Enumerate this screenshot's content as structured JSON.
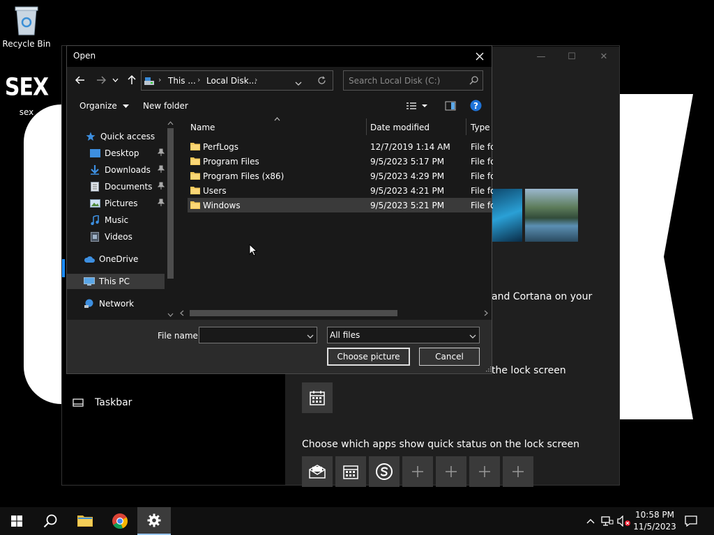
{
  "desktop": {
    "recycle_bin_label": "Recycle Bin",
    "sex_icon_big_text": "SEX",
    "sex_icon_label": "sex"
  },
  "settings": {
    "cortana_text": "and Cortana on your",
    "lock_screen_text": "the lock screen",
    "quick_status_text": "Choose which apps show quick status on the lock screen",
    "taskbar_label": "Taskbar"
  },
  "dialog": {
    "title": "Open",
    "address": {
      "seg1": "This ...",
      "seg2": "Local Disk..."
    },
    "search_placeholder": "Search Local Disk (C:)",
    "organize_label": "Organize",
    "new_folder_label": "New folder",
    "nav_items": [
      {
        "label": "Quick access",
        "icon": "star-icon"
      },
      {
        "label": "Desktop",
        "icon": "desktop-folder-icon"
      },
      {
        "label": "Downloads",
        "icon": "download-icon"
      },
      {
        "label": "Documents",
        "icon": "documents-icon"
      },
      {
        "label": "Pictures",
        "icon": "pictures-icon"
      },
      {
        "label": "Music",
        "icon": "music-icon"
      },
      {
        "label": "Videos",
        "icon": "videos-icon"
      },
      {
        "label": "OneDrive",
        "icon": "cloud-icon"
      },
      {
        "label": "This PC",
        "icon": "computer-icon"
      },
      {
        "label": "Network",
        "icon": "network-icon"
      }
    ],
    "columns": {
      "name": "Name",
      "date": "Date modified",
      "type": "Type"
    },
    "files": [
      {
        "name": "PerfLogs",
        "date": "12/7/2019 1:14 AM",
        "type": "File folder"
      },
      {
        "name": "Program Files",
        "date": "9/5/2023 5:17 PM",
        "type": "File folder"
      },
      {
        "name": "Program Files (x86)",
        "date": "9/5/2023 4:29 PM",
        "type": "File folder"
      },
      {
        "name": "Users",
        "date": "9/5/2023 4:21 PM",
        "type": "File folder"
      },
      {
        "name": "Windows",
        "date": "9/5/2023 5:21 PM",
        "type": "File folder"
      }
    ],
    "file_name_label": "File name:",
    "file_name_value": "",
    "filter_value": "All files",
    "choose_label": "Choose picture",
    "cancel_label": "Cancel"
  },
  "taskbar": {
    "time": "10:58 PM",
    "date": "11/5/2023"
  },
  "colors": {
    "folder": "#f4c95a",
    "accent": "#1a8cff",
    "help": "#1e73d8"
  }
}
